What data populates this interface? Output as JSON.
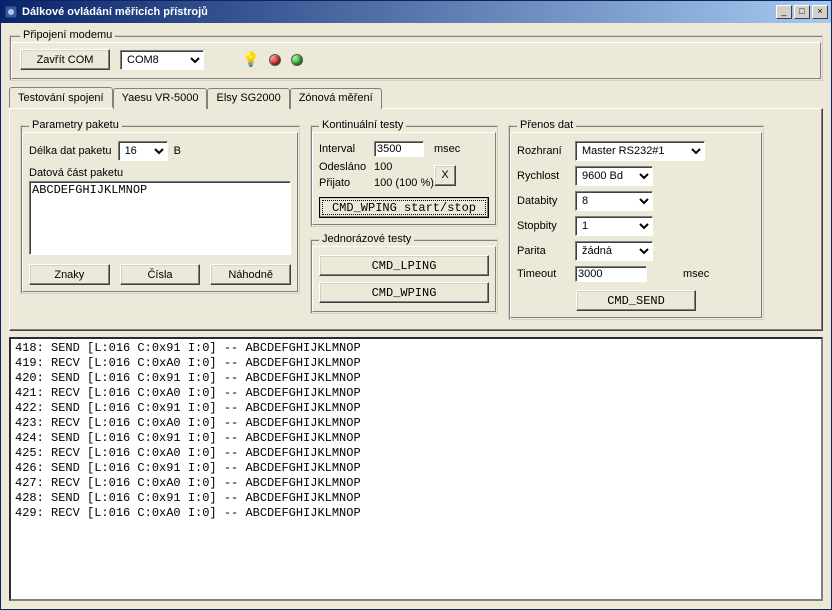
{
  "window": {
    "title": "Dálkové ovládání měřicích přístrojů"
  },
  "modem": {
    "legend": "Připojení modemu",
    "close_btn": "Zavřít COM",
    "port": "COM8"
  },
  "tabs": {
    "t0": "Testování spojení",
    "t1": "Yaesu VR-5000",
    "t2": "Elsy SG2000",
    "t3": "Zónová měření"
  },
  "params": {
    "legend": "Parametry paketu",
    "length_label": "Délka dat paketu",
    "length_value": "16",
    "unit": "B",
    "data_label": "Datová část paketu",
    "data_value": "ABCDEFGHIJKLMNOP",
    "btn_chars": "Znaky",
    "btn_nums": "Čísla",
    "btn_rand": "Náhodně"
  },
  "kont": {
    "legend": "Kontinuální testy",
    "interval_label": "Interval",
    "interval_value": "3500",
    "interval_unit": "msec",
    "sent_label": "Odesláno",
    "sent_value": "100",
    "recv_label": "Přijato",
    "recv_value": "100 (100 %)",
    "x": "X",
    "cmd_btn": "CMD_WPING start/stop"
  },
  "jedn": {
    "legend": "Jednorázové testy",
    "lping": "CMD_LPING",
    "wping": "CMD_WPING"
  },
  "prenos": {
    "legend": "Přenos dat",
    "iface_label": "Rozhraní",
    "iface_value": "Master RS232#1",
    "speed_label": "Rychlost",
    "speed_value": "9600 Bd",
    "databits_label": "Databity",
    "databits_value": "8",
    "stopbits_label": "Stopbity",
    "stopbits_value": "1",
    "parity_label": "Parita",
    "parity_value": "žádná",
    "timeout_label": "Timeout",
    "timeout_value": "3000",
    "timeout_unit": "msec",
    "send_btn": "CMD_SEND"
  },
  "log_lines": [
    "418: SEND [L:016 C:0x91 I:0] -- ABCDEFGHIJKLMNOP",
    "419: RECV [L:016 C:0xA0 I:0] -- ABCDEFGHIJKLMNOP",
    "420: SEND [L:016 C:0x91 I:0] -- ABCDEFGHIJKLMNOP",
    "421: RECV [L:016 C:0xA0 I:0] -- ABCDEFGHIJKLMNOP",
    "422: SEND [L:016 C:0x91 I:0] -- ABCDEFGHIJKLMNOP",
    "423: RECV [L:016 C:0xA0 I:0] -- ABCDEFGHIJKLMNOP",
    "424: SEND [L:016 C:0x91 I:0] -- ABCDEFGHIJKLMNOP",
    "425: RECV [L:016 C:0xA0 I:0] -- ABCDEFGHIJKLMNOP",
    "426: SEND [L:016 C:0x91 I:0] -- ABCDEFGHIJKLMNOP",
    "427: RECV [L:016 C:0xA0 I:0] -- ABCDEFGHIJKLMNOP",
    "428: SEND [L:016 C:0x91 I:0] -- ABCDEFGHIJKLMNOP",
    "429: RECV [L:016 C:0xA0 I:0] -- ABCDEFGHIJKLMNOP"
  ]
}
